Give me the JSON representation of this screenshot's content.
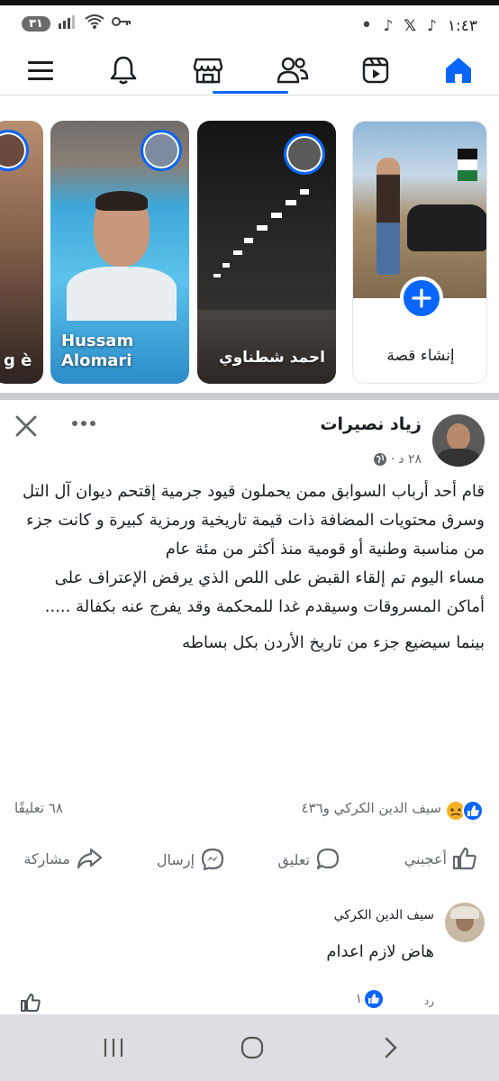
{
  "status_bar": {
    "battery": "٣١",
    "time": "١:٤٣",
    "notification_dot": "•"
  },
  "nav": {
    "items": [
      {
        "name": "menu-icon"
      },
      {
        "name": "bell-icon"
      },
      {
        "name": "marketplace-icon"
      },
      {
        "name": "friends-icon"
      },
      {
        "name": "video-icon"
      },
      {
        "name": "home-icon"
      }
    ]
  },
  "stories": {
    "items": [
      {
        "name": "g è"
      },
      {
        "name": "Hussam Alomari"
      },
      {
        "name": "احمد شطناوي"
      },
      {
        "name": "إنشاء قصة"
      }
    ]
  },
  "post": {
    "author": "زياد نصيرات",
    "time": "٢٨ د",
    "separator": "·",
    "paragraphs": [
      "قام أحد أرباب السوابق ممن يحملون قيود جرمية إقتحم ديوان آل التل وسرق محتويات المضافة ذات قيمة تاريخية ورمزية كبيرة و كانت جزء من مناسبة وطنية أو قومية منذ أكثر من مئة عام",
      "مساء اليوم تم إلقاء القبض على اللص الذي يرفض الإعتراف على أماكن المسروقات وسيقدم غدا للمحكمة وقد يفرج عنه بكفالة .....",
      "بينما سيضيع جزء من تاريخ الأردن بكل بساطه"
    ],
    "reactions_text": "سيف الدين الكركي و٤٣٦",
    "comments_count": "٦٨ تعليقًا",
    "actions": {
      "like": "أعجبني",
      "comment": "تعليق",
      "send": "إرسال",
      "share": "مشاركة"
    }
  },
  "comment": {
    "author": "سيف الدين الكركي",
    "text": "هاض لازم اعدام",
    "reply": "رد",
    "like_count": "١"
  },
  "colors": {
    "accent": "#0866ff",
    "muted": "#65676b",
    "angry": "#f7b125"
  }
}
